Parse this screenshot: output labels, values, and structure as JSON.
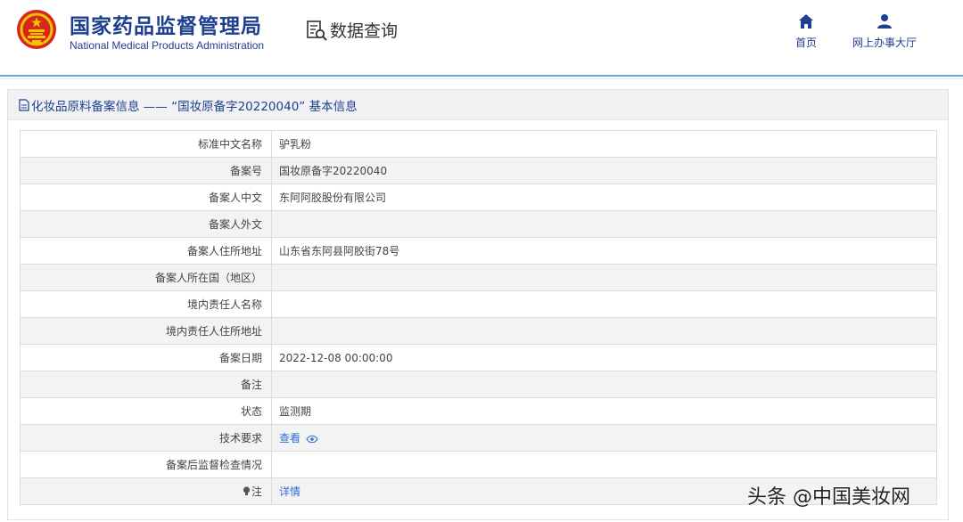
{
  "header": {
    "org_name_cn": "国家药品监督管理局",
    "org_name_en": "National Medical Products Administration",
    "page_label": "数据查询",
    "nav": [
      {
        "label": "首页",
        "icon": "home-icon"
      },
      {
        "label": "网上办事大厅",
        "icon": "user-icon"
      }
    ]
  },
  "panel": {
    "title": "化妆品原料备案信息 —— “国妆原备字20220040” 基本信息"
  },
  "table": {
    "rows": [
      {
        "key": "标准中文名称",
        "value": "驴乳粉"
      },
      {
        "key": "备案号",
        "value": "国妆原备字20220040"
      },
      {
        "key": "备案人中文",
        "value": "东阿阿胶股份有限公司"
      },
      {
        "key": "备案人外文",
        "value": ""
      },
      {
        "key": "备案人住所地址",
        "value": "山东省东阿县阿胶街78号"
      },
      {
        "key": "备案人所在国（地区）",
        "value": ""
      },
      {
        "key": "境内责任人名称",
        "value": ""
      },
      {
        "key": "境内责任人住所地址",
        "value": ""
      },
      {
        "key": "备案日期",
        "value": "2022-12-08 00:00:00"
      },
      {
        "key": "备注",
        "value": ""
      },
      {
        "key": "状态",
        "value": "监测期"
      },
      {
        "key": "技术要求",
        "value": "查看"
      },
      {
        "key": "备案后监督检查情况",
        "value": ""
      },
      {
        "key": "注",
        "value": "详情"
      }
    ]
  },
  "watermark": "头条 @中国美妆网",
  "colors": {
    "brand": "#1f3f8f",
    "link": "#2f6fd1",
    "emblem_red": "#d7261e",
    "emblem_gold": "#f2c400"
  }
}
